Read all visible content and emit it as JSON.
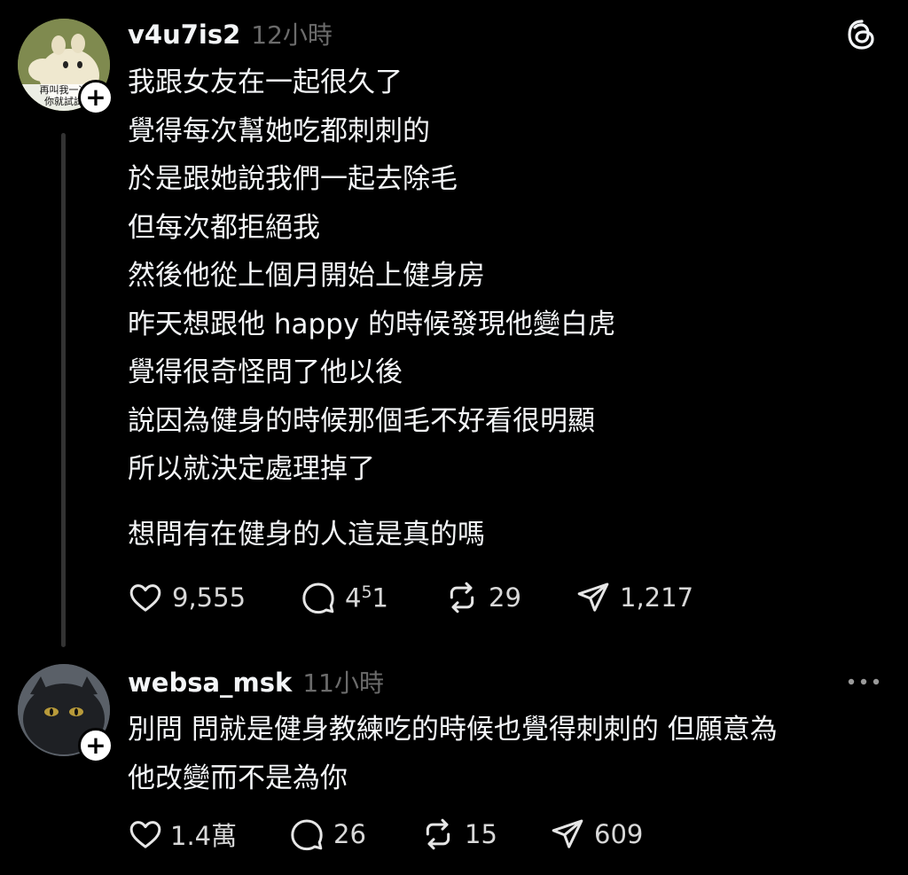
{
  "post": {
    "username": "v4u7is2",
    "time": "12小時",
    "avatar_caption_1": "再叫我一次",
    "avatar_caption_2": "你就試試",
    "lines": [
      "我跟女友在一起很久了",
      "覺得每次幫她吃都刺刺的",
      "於是跟她說我們一起去除毛",
      "但每次都拒絕我",
      "然後他從上個月開始上健身房",
      "昨天想跟他 happy 的時候發現他變白虎",
      "覺得很奇怪問了他以後",
      "說因為健身的時候那個毛不好看很明顯",
      "所以就決定處理掉了"
    ],
    "question": "想問有在健身的人這是真的嗎",
    "likes": "9,555",
    "comments_main": "4",
    "comments_sup": "5",
    "comments_tail": "1",
    "reposts": "29",
    "shares": "1,217"
  },
  "reply": {
    "username": "websa_msk",
    "time": "11小時",
    "lines": [
      "別問 問就是健身教練吃的時候也覺得刺刺的 但願意為",
      "他改變而不是為你"
    ],
    "likes": "1.4萬",
    "comments": "26",
    "reposts": "15",
    "shares": "609"
  },
  "icons": [
    "threads-logo-icon",
    "heart-icon",
    "comment-icon",
    "repost-icon",
    "share-icon",
    "more-options-icon",
    "follow-plus-icon"
  ],
  "colors": {
    "background": "#000000",
    "text": "#f3f5f7",
    "muted": "#6b6b6b",
    "thread_line": "#333333"
  }
}
